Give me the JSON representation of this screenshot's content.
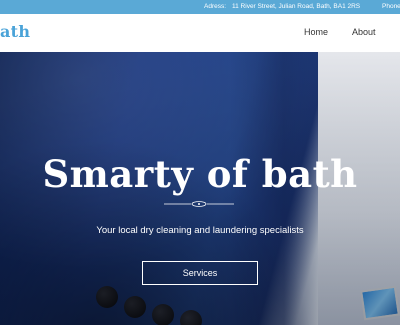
{
  "topbar": {
    "address_label": "Adress:",
    "address_value": "11 River Street, Julian Road, Bath, BA1 2RS",
    "phone_label": "Phone"
  },
  "header": {
    "logo_text": "ath",
    "nav": [
      {
        "label": "Home"
      },
      {
        "label": "About"
      }
    ]
  },
  "hero": {
    "title": "Smarty of bath",
    "tagline": "Your local dry cleaning and laundering specialists",
    "cta_label": "Services"
  },
  "colors": {
    "topbar": "#5aa9d6",
    "logo": "#4aa3d8",
    "hero_text": "#ffffff"
  }
}
